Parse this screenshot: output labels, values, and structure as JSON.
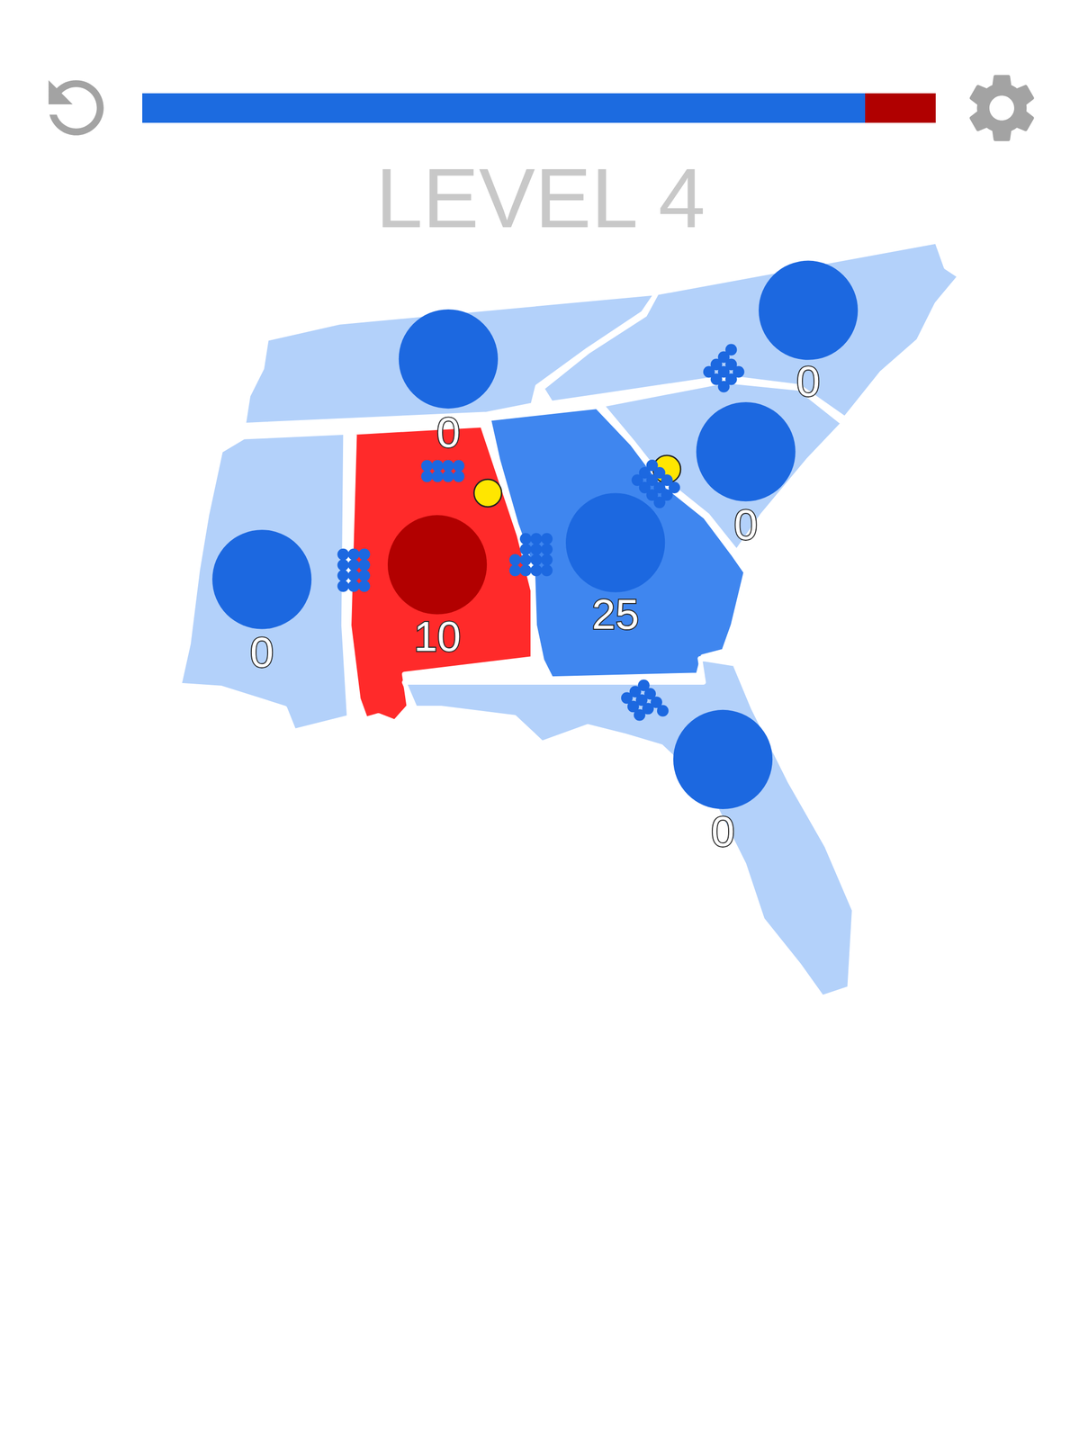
{
  "level_title": "LEVEL 4",
  "progress": {
    "segments": [
      {
        "owner": "player",
        "level": 0.911,
        "color": "#1c6be0"
      },
      {
        "owner": "enemy",
        "level": 0.089,
        "color": "#b00000"
      }
    ]
  },
  "states": [
    {
      "name": "Tennessee",
      "owner": "neutral",
      "count": "0"
    },
    {
      "name": "North Carolina",
      "owner": "neutral",
      "count": "0"
    },
    {
      "name": "South Carolina",
      "owner": "neutral",
      "count": "0"
    },
    {
      "name": "Georgia",
      "owner": "player",
      "count": "25"
    },
    {
      "name": "Alabama",
      "owner": "enemy",
      "count": "10"
    },
    {
      "name": "Mississippi",
      "owner": "neutral",
      "count": "0"
    },
    {
      "name": "Florida",
      "owner": "neutral",
      "count": "0"
    }
  ],
  "armies": [
    {
      "from": "Georgia",
      "to": "Tennessee",
      "owner": "player",
      "units": 8
    },
    {
      "from": "Georgia",
      "to": "Mississippi",
      "owner": "player",
      "units": 12
    },
    {
      "from": "Georgia",
      "to": "Alabama",
      "owner": "player",
      "units": 14
    },
    {
      "from": "Georgia",
      "to": "South Carolina",
      "owner": "player",
      "units": 12
    },
    {
      "from": "Georgia",
      "to": "North Carolina",
      "owner": "player",
      "units": 10
    },
    {
      "from": "Georgia",
      "to": "Florida",
      "owner": "player",
      "units": 10
    }
  ],
  "pickups": [
    {
      "near": "Alabama"
    },
    {
      "near": "South Carolina"
    }
  ]
}
